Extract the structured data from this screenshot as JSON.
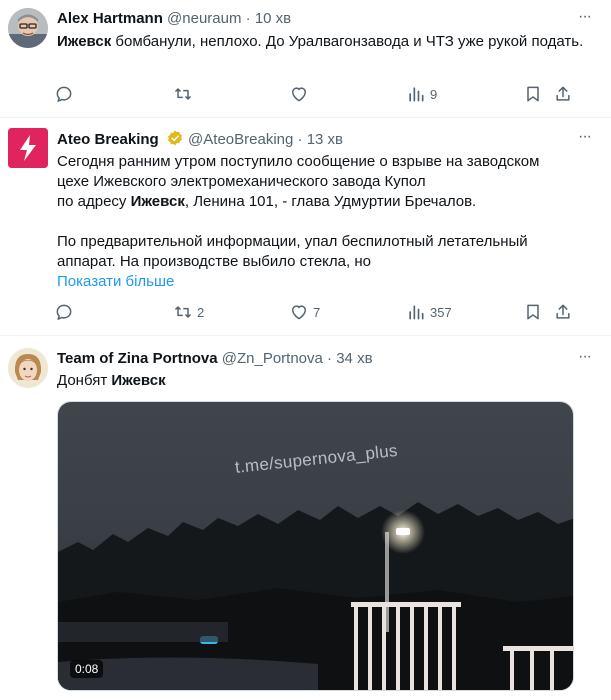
{
  "tweets": [
    {
      "name": "Alex Hartmann",
      "handle": "@neuraum",
      "time": "10 хв",
      "text_parts": [
        "Ижевск",
        " бомбанули, неплохо. До Уралвагонзавода и ЧТЗ уже рукой подать."
      ],
      "stats": {
        "views": "9"
      }
    },
    {
      "name": "Ateo Breaking",
      "handle": "@AteoBreaking",
      "time": "13 хв",
      "line1": "Сегодня ранним утром поступило сообщение о взрыве на заводском",
      "line2": "цехе Ижевского электромеханического завода Купол",
      "line3_pre": "по адресу ",
      "line3_bold": "Ижевск",
      "line3_post": ", Ленина 101, - глава Удмуртии Бречалов.",
      "para2": "По предварительной информации, упал беспилотный летательный аппарат. На производстве выбило стекла, но",
      "show_more": "Показати більше",
      "stats": {
        "retweets": "2",
        "likes": "7",
        "views": "357"
      }
    },
    {
      "name": "Team of Zina Portnova",
      "handle": "@Zn_Portnova",
      "time": "34 хв",
      "text_pre": "Донбят ",
      "text_bold": "Ижевск",
      "media": {
        "watermark": "t.me/supernova_plus",
        "duration": "0:08"
      }
    }
  ],
  "separator": "·",
  "colors": {
    "accent": "#1d9bf0",
    "secondary": "#536471",
    "breaking_red": "#e0245e",
    "verified_gold": "#e2b719"
  }
}
